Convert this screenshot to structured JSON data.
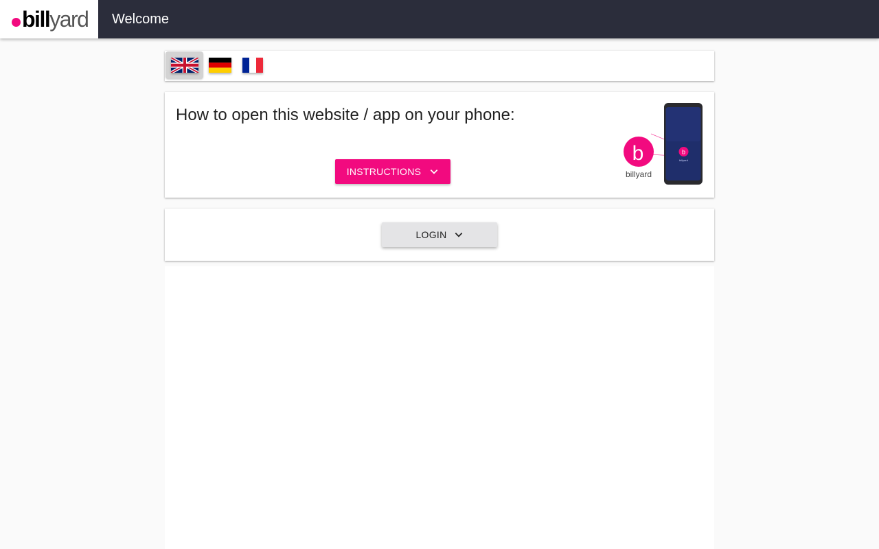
{
  "header": {
    "logo_bold": "bill",
    "logo_light": "yard",
    "title": "Welcome"
  },
  "language_bar": {
    "flags": [
      {
        "name": "uk-flag-icon",
        "selected": true
      },
      {
        "name": "germany-flag-icon",
        "selected": false
      },
      {
        "name": "france-flag-icon",
        "selected": false
      }
    ]
  },
  "instructions": {
    "heading": "How to open this website / app on your phone:",
    "button_label": "INSTRUCTIONS",
    "button_icon": "chevron-down-icon",
    "illustration": {
      "app_icon_letter": "b",
      "app_label": "billyard",
      "phone_icon_label": "billyard"
    }
  },
  "login": {
    "button_label": "LOGIN",
    "button_icon": "chevron-down-icon"
  },
  "colors": {
    "accent": "#f20a7f",
    "topbar": "#2b2d3b",
    "page_bg": "#fafafa",
    "login_button": "#e4e4e6"
  }
}
